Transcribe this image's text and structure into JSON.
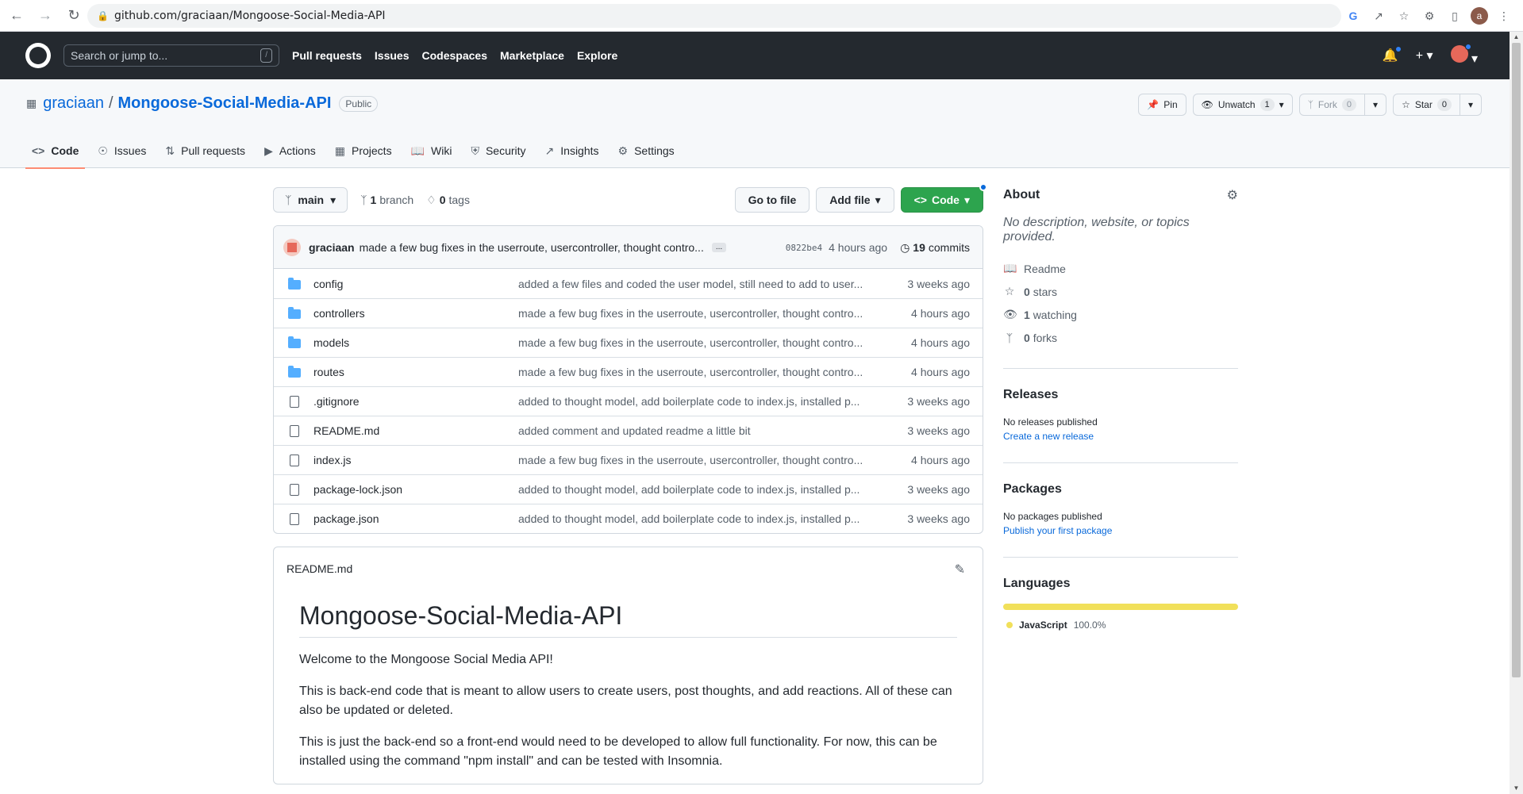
{
  "browser": {
    "url": "github.com/graciaan/Mongoose-Social-Media-API",
    "profile_initial": "a"
  },
  "gh_header": {
    "search_placeholder": "Search or jump to...",
    "search_shortcut": "/",
    "nav": [
      "Pull requests",
      "Issues",
      "Codespaces",
      "Marketplace",
      "Explore"
    ]
  },
  "repo": {
    "owner": "graciaan",
    "separator": "/",
    "name": "Mongoose-Social-Media-API",
    "visibility": "Public",
    "pin_label": "Pin",
    "watch_label": "Unwatch",
    "watch_count": "1",
    "fork_label": "Fork",
    "fork_count": "0",
    "star_label": "Star",
    "star_count": "0"
  },
  "tabs": [
    {
      "label": "Code",
      "icon": "code-icon"
    },
    {
      "label": "Issues",
      "icon": "issue-icon"
    },
    {
      "label": "Pull requests",
      "icon": "pull-request-icon"
    },
    {
      "label": "Actions",
      "icon": "play-icon"
    },
    {
      "label": "Projects",
      "icon": "table-icon"
    },
    {
      "label": "Wiki",
      "icon": "book-icon"
    },
    {
      "label": "Security",
      "icon": "shield-icon"
    },
    {
      "label": "Insights",
      "icon": "graph-icon"
    },
    {
      "label": "Settings",
      "icon": "gear-icon"
    }
  ],
  "file_nav": {
    "branch": "main",
    "branch_count": "1",
    "branch_word": "branch",
    "tag_count": "0",
    "tag_word": "tags",
    "go_to_file": "Go to file",
    "add_file": "Add file",
    "code": "Code"
  },
  "commit": {
    "author": "graciaan",
    "message": "made a few bug fixes in the userroute, usercontroller, thought contro...",
    "ellipsis": "...",
    "sha": "0822be4",
    "time": "4 hours ago",
    "commit_count": "19",
    "commit_word": "commits"
  },
  "files": [
    {
      "name": "config",
      "type": "folder",
      "message": "added a few files and coded the user model, still need to add to user...",
      "age": "3 weeks ago"
    },
    {
      "name": "controllers",
      "type": "folder",
      "message": "made a few bug fixes in the userroute, usercontroller, thought contro...",
      "age": "4 hours ago"
    },
    {
      "name": "models",
      "type": "folder",
      "message": "made a few bug fixes in the userroute, usercontroller, thought contro...",
      "age": "4 hours ago"
    },
    {
      "name": "routes",
      "type": "folder",
      "message": "made a few bug fixes in the userroute, usercontroller, thought contro...",
      "age": "4 hours ago"
    },
    {
      "name": ".gitignore",
      "type": "file",
      "message": "added to thought model, add boilerplate code to index.js, installed p...",
      "age": "3 weeks ago"
    },
    {
      "name": "README.md",
      "type": "file",
      "message": "added comment and updated readme a little bit",
      "age": "3 weeks ago"
    },
    {
      "name": "index.js",
      "type": "file",
      "message": "made a few bug fixes in the userroute, usercontroller, thought contro...",
      "age": "4 hours ago"
    },
    {
      "name": "package-lock.json",
      "type": "file",
      "message": "added to thought model, add boilerplate code to index.js, installed p...",
      "age": "3 weeks ago"
    },
    {
      "name": "package.json",
      "type": "file",
      "message": "added to thought model, add boilerplate code to index.js, installed p...",
      "age": "3 weeks ago"
    }
  ],
  "readme": {
    "filename": "README.md",
    "title": "Mongoose-Social-Media-API",
    "paragraphs": [
      "Welcome to the Mongoose Social Media API!",
      "This is back-end code that is meant to allow users to create users, post thoughts, and add reactions. All of these can also be updated or deleted.",
      "This is just the back-end so a front-end would need to be developed to allow full functionality. For now, this can be installed using the command \"npm install\" and can be tested with Insomnia."
    ]
  },
  "about": {
    "heading": "About",
    "description": "No description, website, or topics provided.",
    "readme": "Readme",
    "stars_count": "0",
    "stars_word": "stars",
    "watching_count": "1",
    "watching_word": "watching",
    "forks_count": "0",
    "forks_word": "forks"
  },
  "releases": {
    "heading": "Releases",
    "none": "No releases published",
    "create": "Create a new release"
  },
  "packages": {
    "heading": "Packages",
    "none": "No packages published",
    "publish": "Publish your first package"
  },
  "languages": {
    "heading": "Languages",
    "items": [
      {
        "name": "JavaScript",
        "percent": "100.0%",
        "color": "#f1e05a"
      }
    ]
  }
}
